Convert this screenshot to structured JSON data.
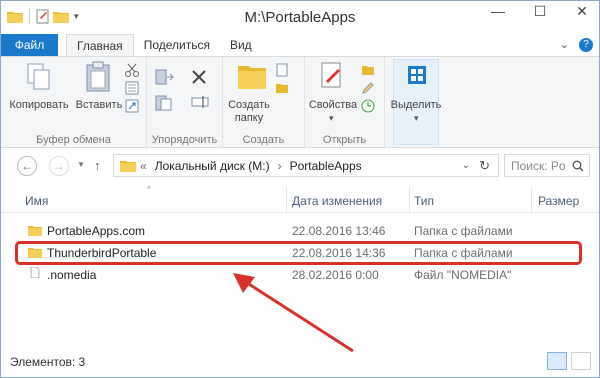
{
  "window": {
    "title": "M:\\PortableApps"
  },
  "ribbon_tabs": {
    "file": "Файл",
    "home": "Главная",
    "share": "Поделиться",
    "view": "Вид"
  },
  "ribbon": {
    "copy": "Копировать",
    "paste": "Вставить",
    "clipboard_group": "Буфер обмена",
    "organize_group": "Упорядочить",
    "new_folder_line1": "Создать",
    "new_folder_line2": "папку",
    "create_group": "Создать",
    "properties": "Свойства",
    "open_group": "Открыть",
    "select": "Выделить"
  },
  "address": {
    "prefix": "«",
    "drive": "Локальный диск (M:)",
    "sep": "›",
    "folder": "PortableApps"
  },
  "search": {
    "placeholder": "Поиск: Po"
  },
  "columns": {
    "name": "Имя",
    "date": "Дата изменения",
    "type": "Тип",
    "size": "Размер"
  },
  "files": [
    {
      "name": "PortableApps.com",
      "date": "22.08.2016 13:46",
      "type": "Папка с файлами"
    },
    {
      "name": "ThunderbirdPortable",
      "date": "22.08.2016 14:36",
      "type": "Папка с файлами"
    },
    {
      "name": ".nomedia",
      "date": "28.02.2016 0:00",
      "type": "Файл \"NOMEDIA\""
    }
  ],
  "status": {
    "count": "Элементов: 3"
  },
  "colors": {
    "accent": "#1979ca",
    "annotation": "#d9302a",
    "folder": "#e8b830"
  }
}
